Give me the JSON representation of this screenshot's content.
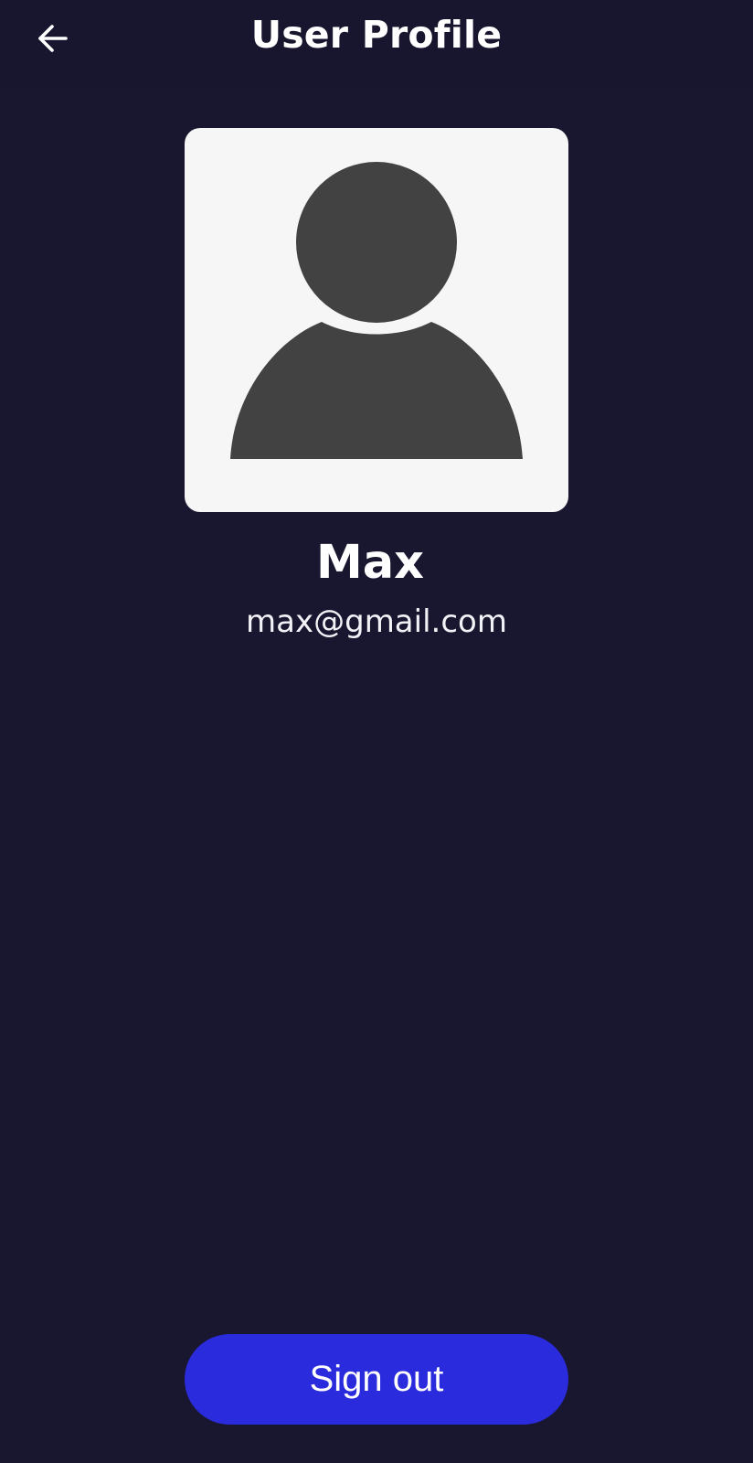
{
  "header": {
    "title": "User Profile",
    "back_icon": "arrow-left-icon"
  },
  "profile": {
    "avatar_icon": "person-silhouette-icon",
    "name": "Max",
    "email": "max@gmail.com"
  },
  "actions": {
    "sign_out_label": "Sign out"
  },
  "colors": {
    "background": "#191730",
    "avatar_background": "#f6f6f6",
    "avatar_silhouette": "#424242",
    "sign_out_button": "#2a2bdd",
    "text": "#ffffff"
  }
}
